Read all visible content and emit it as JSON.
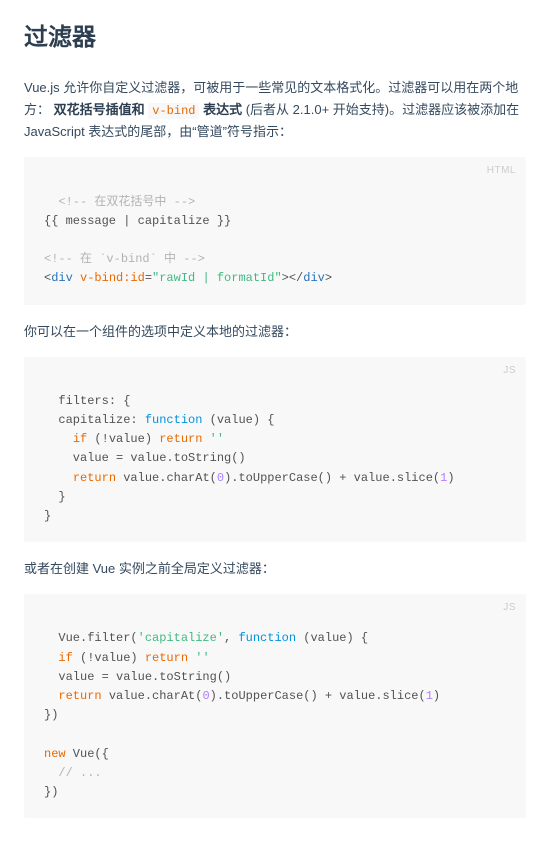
{
  "title": "过滤器",
  "intro": {
    "pre": "Vue.js 允许你自定义过滤器，可被用于一些常见的文本格式化。过滤器可以用在两个地方：",
    "bold1": "双花括号插值和 ",
    "vbind": "v-bind",
    "bold2": " 表达式",
    "post": " (后者从 2.1.0+ 开始支持)。过滤器应该被添加在 JavaScript 表达式的尾部，由“管道”符号指示："
  },
  "code1": {
    "lang": "HTML",
    "l1": "<!-- 在双花括号中 -->",
    "l2": "{{ message | capitalize }}",
    "l3": "",
    "l4_a": "<!-- 在 `",
    "l4_vb": "v-bind",
    "l4_b": "` 中 -->",
    "l5_open": "<",
    "l5_tag": "div",
    "l5_sp": " ",
    "l5_attr": "v-bind:id",
    "l5_eq": "=",
    "l5_val": "\"rawId | formatId\"",
    "l5_mid": "></",
    "l5_tag2": "div",
    "l5_close": ">"
  },
  "para2": "你可以在一个组件的选项中定义本地的过滤器：",
  "code2": {
    "lang": "JS",
    "l1": "filters: {",
    "l2_a": "  capitalize: ",
    "l2_fn": "function",
    "l2_b": " (value) {",
    "l3_a": "    ",
    "l3_if": "if",
    "l3_b": " (!value) ",
    "l3_ret": "return",
    "l3_c": " ",
    "l3_str": "''",
    "l4": "    value = value.toString()",
    "l5_a": "    ",
    "l5_ret": "return",
    "l5_b": " value.charAt(",
    "l5_n": "0",
    "l5_c": ").toUpperCase() + value.slice(",
    "l5_n2": "1",
    "l5_d": ")",
    "l6": "  }",
    "l7": "}"
  },
  "para3": "或者在创建 Vue 实例之前全局定义过滤器：",
  "code3": {
    "lang": "JS",
    "l1_a": "Vue.filter(",
    "l1_s": "'capitalize'",
    "l1_b": ", ",
    "l1_fn": "function",
    "l1_c": " (value) {",
    "l2_a": "  ",
    "l2_if": "if",
    "l2_b": " (!value) ",
    "l2_ret": "return",
    "l2_c": " ",
    "l2_str": "''",
    "l3": "  value = value.toString()",
    "l4_a": "  ",
    "l4_ret": "return",
    "l4_b": " value.charAt(",
    "l4_n": "0",
    "l4_c": ").toUpperCase() + value.slice(",
    "l4_n2": "1",
    "l4_d": ")",
    "l5": "})",
    "l6": "",
    "l7_new": "new",
    "l7_b": " Vue({",
    "l8_a": "  ",
    "l8_c": "// ...",
    "l9": "})"
  }
}
